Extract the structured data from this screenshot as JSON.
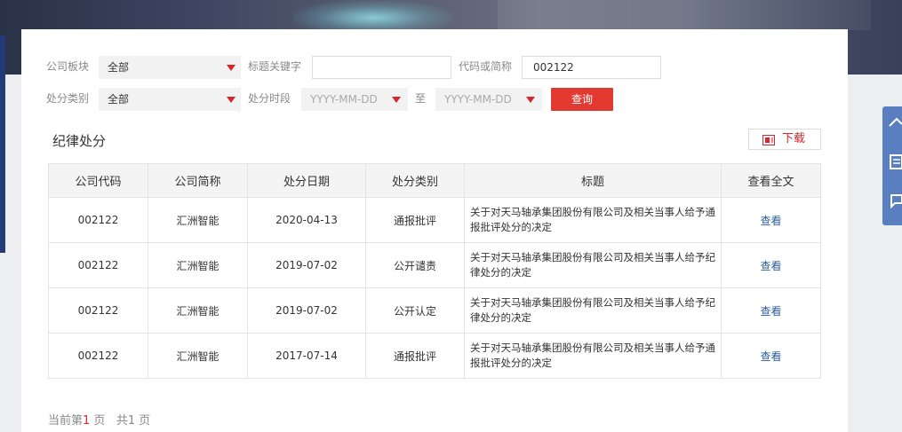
{
  "filters": {
    "board_label": "公司板块",
    "board_value": "全部",
    "keyword_label": "标题关键字",
    "keyword_value": "",
    "code_label": "代码或简称",
    "code_value": "002122",
    "category_label": "处分类别",
    "category_value": "全部",
    "period_label": "处分时段",
    "date_from_placeholder": "YYYY-MM-DD",
    "to_label": "至",
    "date_to_placeholder": "YYYY-MM-DD",
    "query_label": "查询"
  },
  "section": {
    "title": "纪律处分",
    "download_label": "下载"
  },
  "table": {
    "headers": [
      "公司代码",
      "公司简称",
      "处分日期",
      "处分类别",
      "标题",
      "查看全文"
    ],
    "rows": [
      {
        "code": "002122",
        "name": "汇洲智能",
        "date": "2020-04-13",
        "category": "通报批评",
        "title": "关于对天马轴承集团股份有限公司及相关当事人给予通报批评处分的决定",
        "view": "查看"
      },
      {
        "code": "002122",
        "name": "汇洲智能",
        "date": "2019-07-02",
        "category": "公开谴责",
        "title": "关于对天马轴承集团股份有限公司及相关当事人给予纪律处分的决定",
        "view": "查看"
      },
      {
        "code": "002122",
        "name": "汇洲智能",
        "date": "2019-07-02",
        "category": "公开认定",
        "title": "关于对天马轴承集团股份有限公司及相关当事人给予纪律处分的决定",
        "view": "查看"
      },
      {
        "code": "002122",
        "name": "汇洲智能",
        "date": "2017-07-14",
        "category": "通报批评",
        "title": "关于对天马轴承集团股份有限公司及相关当事人给予通报批评处分的决定",
        "view": "查看"
      }
    ]
  },
  "pager": {
    "prefix": "当前第",
    "current": "1",
    "page_suffix": " 页",
    "total_prefix": "共1",
    "total_suffix": " 页"
  },
  "colors": {
    "accent": "#e23a33",
    "link": "#2a5d9a"
  }
}
